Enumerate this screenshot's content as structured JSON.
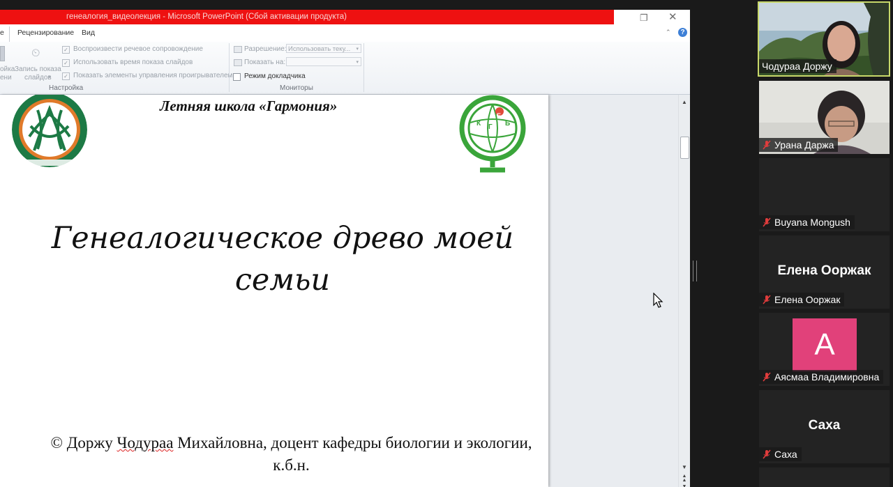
{
  "window": {
    "title": "генеалогия_видеолекция - Microsoft PowerPoint (Сбой активации продукта)"
  },
  "ribbon": {
    "tabs": [
      "е",
      "Рецензирование",
      "Вид"
    ],
    "buttons": {
      "setup_partial": "ойка\nени",
      "record_show": "Запись показа\nслайдов"
    },
    "checkboxes": {
      "narration": "Воспроизвести речевое сопровождение",
      "timings": "Использовать время показа слайдов",
      "controls": "Показать элементы управления проигрывателем",
      "presenter": "Режим докладчика"
    },
    "resolution_label": "Разрешение:",
    "resolution_value": "Использовать теку...",
    "show_on_label": "Показать на:",
    "groups": {
      "setup": "Настройка",
      "monitors": "Мониторы"
    }
  },
  "slide": {
    "school": "Летняя школа «Гармония»",
    "title": "Генеалогическое древо моей семьи",
    "credit_prefix": "© Доржу ",
    "credit_name": "Чодураа",
    "credit_rest": " Михайловна, доцент кафедры биологии и экологии, к.б.н.",
    "right_logo_letters": [
      "К",
      "Г",
      "Б",
      "Е"
    ]
  },
  "participants": [
    {
      "name": "Чодураа Доржу",
      "muted": false,
      "active": true
    },
    {
      "name": "Урана Даржа",
      "muted": true
    },
    {
      "name": "Buyana Mongush",
      "muted": true
    },
    {
      "name": "Елена Ооржак",
      "display": "Елена Ооржак",
      "muted": true
    },
    {
      "name": "Аясмаа Владимировна",
      "avatar_letter": "A",
      "avatar_color": "#e1417a",
      "muted": true
    },
    {
      "name": "Саха",
      "display": "Саха",
      "muted": true
    }
  ],
  "colors": {
    "titlebar_red": "#ee1111",
    "active_speaker_border": "#c8d86a",
    "muted_icon": "#e03c3c"
  }
}
